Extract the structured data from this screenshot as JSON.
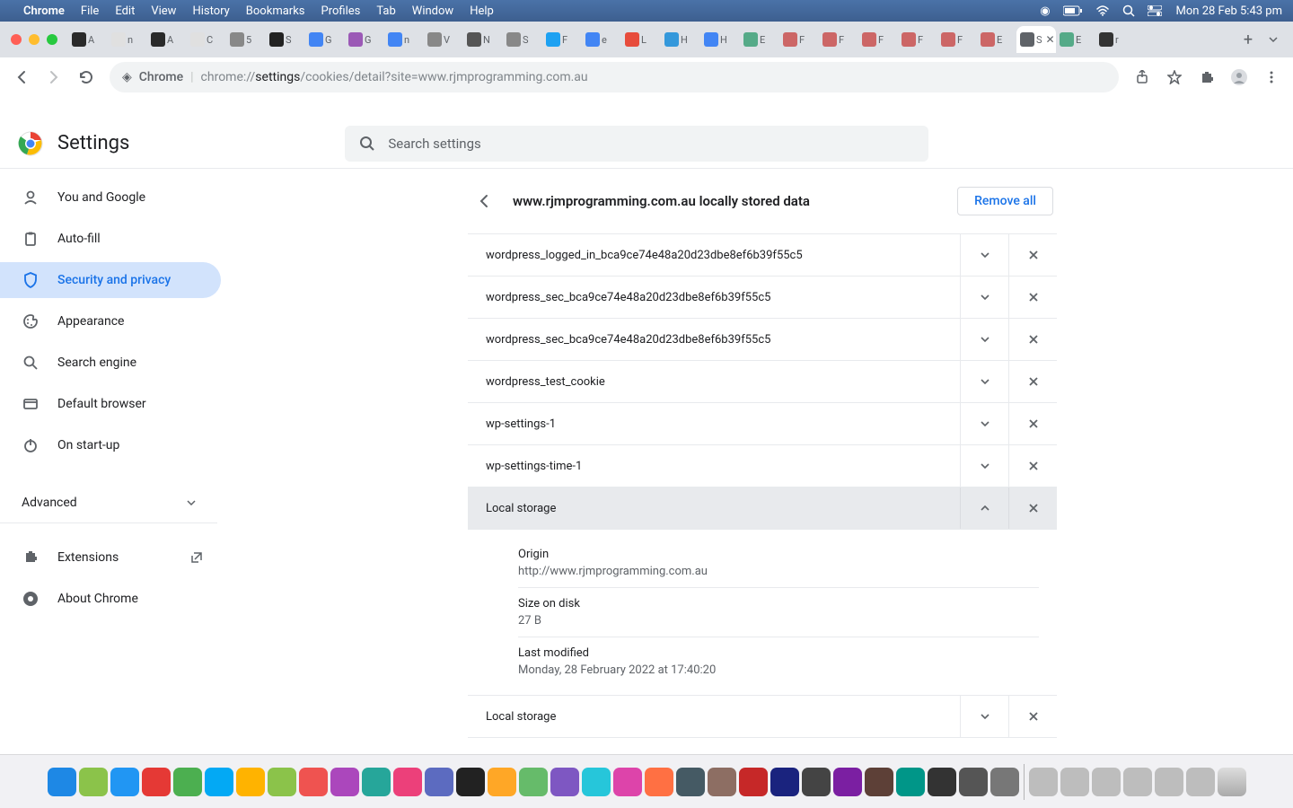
{
  "menubar": {
    "app": "Chrome",
    "items": [
      "File",
      "Edit",
      "View",
      "History",
      "Bookmarks",
      "Profiles",
      "Tab",
      "Window",
      "Help"
    ],
    "clock": "Mon 28 Feb  5:43 pm"
  },
  "tabs": {
    "items": [
      {
        "label": "A",
        "fav": "#2a2a2a"
      },
      {
        "label": "n",
        "fav": "#e0e0e0"
      },
      {
        "label": "A",
        "fav": "#2a2a2a"
      },
      {
        "label": "C",
        "fav": "#e0e0e0"
      },
      {
        "label": "5",
        "fav": "#888"
      },
      {
        "label": "S",
        "fav": "#222"
      },
      {
        "label": "G",
        "fav": "#4285f4"
      },
      {
        "label": "G",
        "fav": "#9b59b6"
      },
      {
        "label": "n",
        "fav": "#4285f4"
      },
      {
        "label": "V",
        "fav": "#888"
      },
      {
        "label": "N",
        "fav": "#555"
      },
      {
        "label": "S",
        "fav": "#888"
      },
      {
        "label": "F",
        "fav": "#1da1f2"
      },
      {
        "label": "e",
        "fav": "#4285f4"
      },
      {
        "label": "L",
        "fav": "#e74c3c"
      },
      {
        "label": "H",
        "fav": "#3498db"
      },
      {
        "label": "H",
        "fav": "#4285f4"
      },
      {
        "label": "E",
        "fav": "#5a8"
      },
      {
        "label": "F",
        "fav": "#c66"
      },
      {
        "label": "F",
        "fav": "#c66"
      },
      {
        "label": "F",
        "fav": "#c66"
      },
      {
        "label": "F",
        "fav": "#c66"
      },
      {
        "label": "F",
        "fav": "#c66"
      },
      {
        "label": "E",
        "fav": "#c66"
      }
    ],
    "active": {
      "label": "S",
      "fav": "#5f6368"
    },
    "trailing": [
      {
        "label": "E",
        "fav": "#5a8"
      },
      {
        "label": "r",
        "fav": "#333"
      }
    ]
  },
  "toolbar": {
    "chrome_label": "Chrome",
    "url_prefix": "chrome://",
    "url_bold": "settings",
    "url_rest": "/cookies/detail?site=www.rjmprogramming.com.au"
  },
  "settings": {
    "title": "Settings",
    "search_placeholder": "Search settings"
  },
  "sidebar": {
    "items": [
      {
        "label": "You and Google",
        "icon": "person"
      },
      {
        "label": "Auto-fill",
        "icon": "clipboard"
      },
      {
        "label": "Security and privacy",
        "icon": "shield"
      },
      {
        "label": "Appearance",
        "icon": "palette"
      },
      {
        "label": "Search engine",
        "icon": "search"
      },
      {
        "label": "Default browser",
        "icon": "window"
      },
      {
        "label": "On start-up",
        "icon": "power"
      }
    ],
    "advanced": "Advanced",
    "extensions": "Extensions",
    "about": "About Chrome"
  },
  "page": {
    "site": "www.rjmprogramming.com.au locally stored data",
    "remove_all": "Remove all"
  },
  "cookies": [
    {
      "name": "wordpress_logged_in_bca9ce74e48a20d23dbe8ef6b39f55c5"
    },
    {
      "name": "wordpress_sec_bca9ce74e48a20d23dbe8ef6b39f55c5"
    },
    {
      "name": "wordpress_sec_bca9ce74e48a20d23dbe8ef6b39f55c5"
    },
    {
      "name": "wordpress_test_cookie"
    },
    {
      "name": "wp-settings-1"
    },
    {
      "name": "wp-settings-time-1"
    }
  ],
  "expanded": {
    "name": "Local storage",
    "details": {
      "origin_label": "Origin",
      "origin_value": "http://www.rjmprogramming.com.au",
      "size_label": "Size on disk",
      "size_value": "27 B",
      "modified_label": "Last modified",
      "modified_value": "Monday, 28 February 2022 at 17:40:20"
    }
  },
  "collapsed_after": {
    "name": "Local storage"
  }
}
